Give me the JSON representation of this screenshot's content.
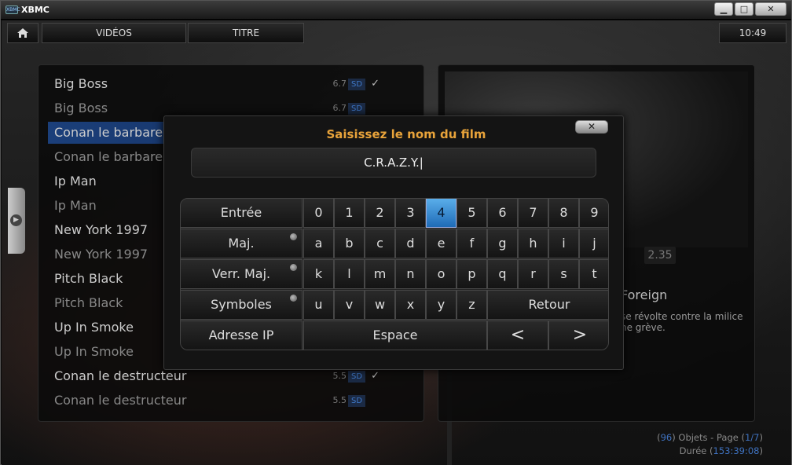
{
  "window": {
    "title": "XBMC",
    "logo_text": "XBMC",
    "minimize": "▁",
    "maximize": "□",
    "close": "✕"
  },
  "header": {
    "home_icon": "home-icon",
    "section": "VIDÉOS",
    "sort": "TITRE",
    "clock": "10:49"
  },
  "list": {
    "items": [
      {
        "title": "Big Boss",
        "rating": "6.7",
        "quality": "SD",
        "watched": "✓"
      },
      {
        "title": "Big Boss",
        "rating": "6.7",
        "quality": "SD",
        "watched": ""
      },
      {
        "title": "Conan le barbare",
        "rating": "",
        "quality": "",
        "watched": ""
      },
      {
        "title": "Conan le barbare",
        "rating": "",
        "quality": "",
        "watched": ""
      },
      {
        "title": "Ip Man",
        "rating": "",
        "quality": "",
        "watched": ""
      },
      {
        "title": "Ip Man",
        "rating": "",
        "quality": "",
        "watched": ""
      },
      {
        "title": "New York 1997",
        "rating": "",
        "quality": "",
        "watched": ""
      },
      {
        "title": "New York 1997",
        "rating": "",
        "quality": "",
        "watched": ""
      },
      {
        "title": "Pitch Black",
        "rating": "",
        "quality": "",
        "watched": ""
      },
      {
        "title": "Pitch Black",
        "rating": "",
        "quality": "",
        "watched": ""
      },
      {
        "title": "Up In Smoke",
        "rating": "",
        "quality": "",
        "watched": ""
      },
      {
        "title": "Up In Smoke",
        "rating": "",
        "quality": "",
        "watched": ""
      },
      {
        "title": "Conan le destructeur",
        "rating": "5.5",
        "quality": "SD",
        "watched": "✓"
      },
      {
        "title": "Conan le destructeur",
        "rating": "5.5",
        "quality": "SD",
        "watched": ""
      }
    ],
    "selected_index": 2
  },
  "info": {
    "aspect_partial": "0",
    "aspect": "2.35",
    "genre": "Foreign",
    "plot_line1": "se révolte contre la milice",
    "plot_line2": "ne grève."
  },
  "footer": {
    "count": "96",
    "objects_label": "Objets - Page",
    "page": "1/7",
    "duration_label": "Durée",
    "duration": "153:39:08"
  },
  "dialog": {
    "title": "Saisissez le nom du film",
    "close": "✕",
    "input_value": "C.R.A.Z.Y.|",
    "keys": {
      "enter": "Entrée",
      "shift": "Maj.",
      "capslock": "Verr. Maj.",
      "symbols": "Symboles",
      "ip": "Adresse IP",
      "space": "Espace",
      "backspace": "Retour",
      "left": "<",
      "right": ">",
      "digits": [
        "0",
        "1",
        "2",
        "3",
        "4",
        "5",
        "6",
        "7",
        "8",
        "9"
      ],
      "row2": [
        "a",
        "b",
        "c",
        "d",
        "e",
        "f",
        "g",
        "h",
        "i",
        "j"
      ],
      "row3": [
        "k",
        "l",
        "m",
        "n",
        "o",
        "p",
        "q",
        "r",
        "s",
        "t"
      ],
      "row4": [
        "u",
        "v",
        "w",
        "x",
        "y",
        "z"
      ]
    },
    "selected_key": "4"
  },
  "colors": {
    "accent_blue": "#1b3f7a",
    "title_orange": "#e8a33a",
    "key_selected": "#3f8fd6"
  }
}
